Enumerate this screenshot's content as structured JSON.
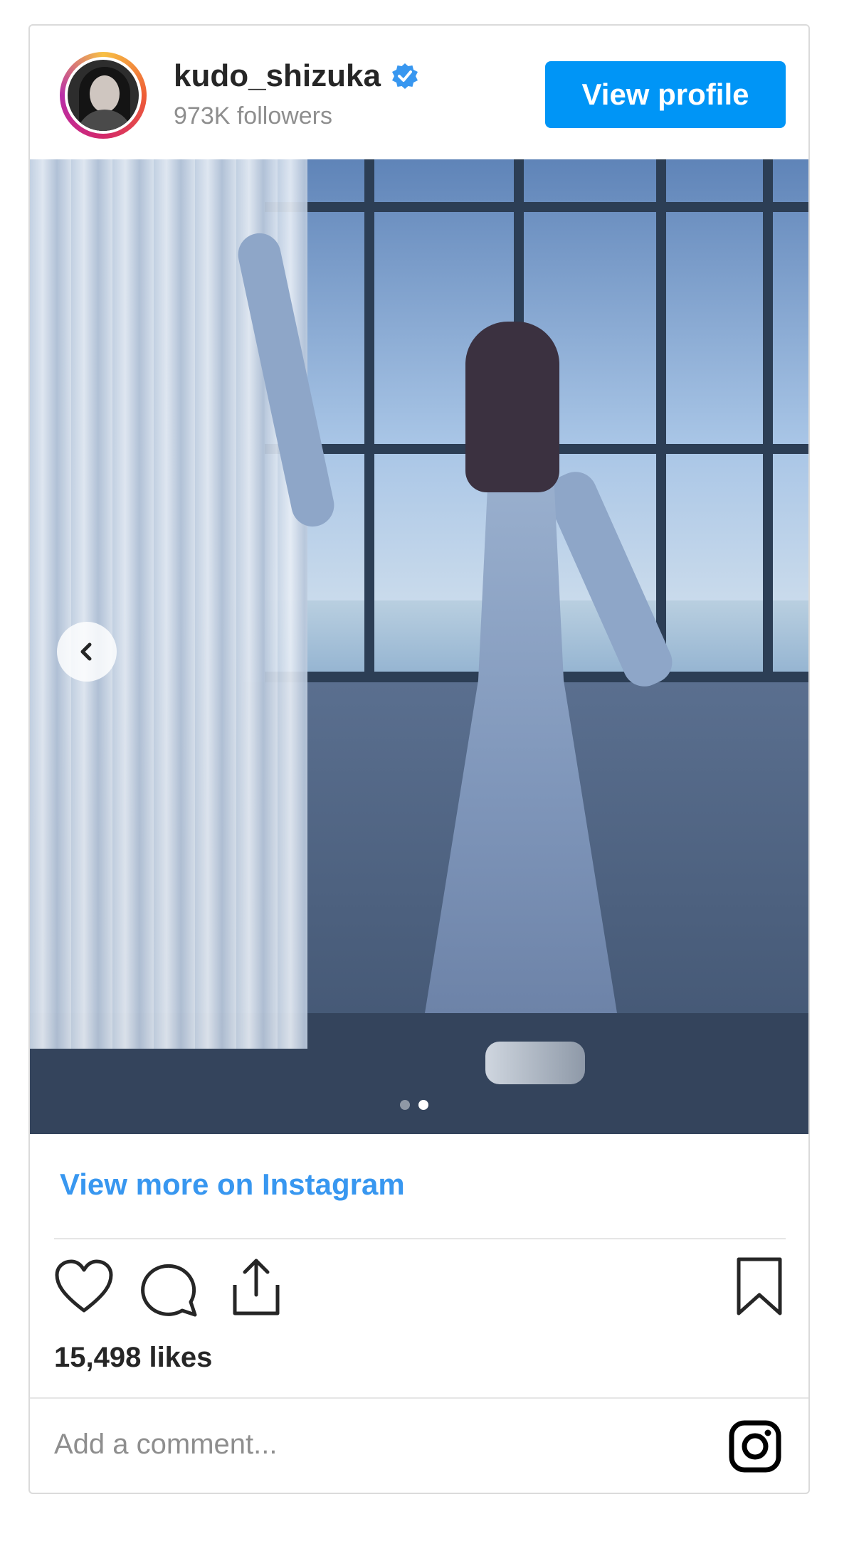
{
  "profile": {
    "username": "kudo_shizuka",
    "followers": "973K followers",
    "verified": true,
    "view_profile_label": "View profile"
  },
  "post": {
    "carousel_total": 2,
    "carousel_active": 2,
    "view_more_label": "View more on Instagram",
    "likes": "15,498 likes",
    "comment_placeholder": "Add a comment..."
  },
  "icons": {
    "verified": "verified-badge-icon",
    "prev": "chevron-left-icon",
    "like": "heart-icon",
    "comment": "comment-bubble-icon",
    "share": "share-icon",
    "save": "bookmark-icon",
    "instagram": "instagram-logo-icon"
  },
  "colors": {
    "accent": "#0095f6",
    "link": "#3897f0",
    "text": "#262626",
    "muted": "#8e8e8e"
  }
}
